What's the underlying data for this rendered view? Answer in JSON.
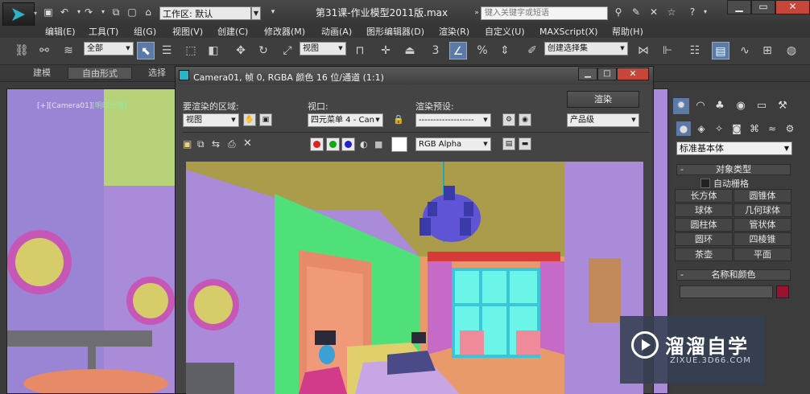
{
  "titlebar": {
    "workspace_label": "工作区: 默认",
    "doc_title": "第31课-作业模型2011版.max",
    "search_placeholder": "键入关键字或短语"
  },
  "menu": {
    "items": [
      "编辑(E)",
      "工具(T)",
      "组(G)",
      "视图(V)",
      "创建(C)",
      "修改器(M)",
      "动画(A)",
      "图形编辑器(D)",
      "渲染(R)",
      "自定义(U)",
      "MAXScript(X)",
      "帮助(H)"
    ]
  },
  "toolbar": {
    "filter_value": "全部",
    "refcoord_value": "视图",
    "selection_set_value": "创建选择集"
  },
  "ribbon": {
    "tabs": [
      "建模",
      "自由形式",
      "选择"
    ]
  },
  "viewport": {
    "label_prefix": "[+][Camera01]",
    "label_mode": "[明暗处理]"
  },
  "render_dialog": {
    "title": "Camera01, 帧 0, RGBA 颜色 16 位/通道 (1:1)",
    "area_label": "要渲染的区域:",
    "area_value": "视图",
    "viewport_label": "视口:",
    "viewport_value": "四元菜单 4 - Can",
    "preset_label": "渲染预设:",
    "preset_value": "-------------------",
    "render_button": "渲染",
    "quality_value": "产品级",
    "channel_value": "RGB Alpha"
  },
  "command_panel": {
    "category_value": "标准基本体",
    "object_type_title": "对象类型",
    "autogrid_label": "自动栅格",
    "object_buttons": [
      "长方体",
      "圆锥体",
      "球体",
      "几何球体",
      "圆柱体",
      "管状体",
      "圆环",
      "四棱锥",
      "茶壶",
      "平面"
    ],
    "name_color_title": "名称和颜色",
    "swatch_color": "#9a1230"
  },
  "watermark": {
    "title": "溜溜自学",
    "url": "ZIXUE.3D66.COM"
  }
}
